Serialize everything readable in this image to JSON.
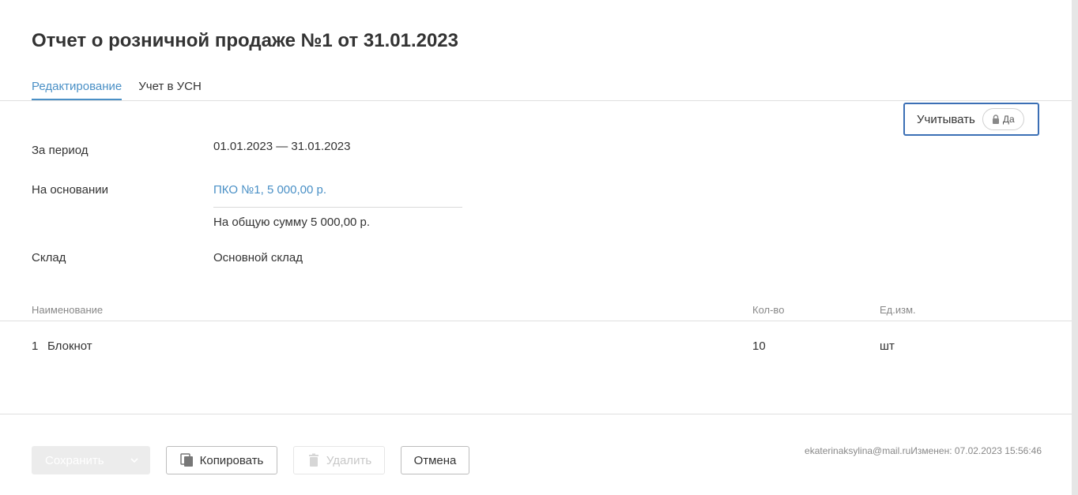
{
  "document": {
    "title": "Отчет о розничной продаже №1 от 31.01.2023"
  },
  "tabs": [
    {
      "label": "Редактирование",
      "active": true
    },
    {
      "label": "Учет в УСН",
      "active": false
    }
  ],
  "tax_accounting": {
    "label": "Учитывать",
    "value": "Да",
    "icon": "lock-icon"
  },
  "fields": {
    "period_label": "За период",
    "period_value": "01.01.2023 — 31.01.2023",
    "basis_label": "На основании",
    "basis_link": "ПКО №1, 5 000,00 р.",
    "basis_total": "На общую сумму 5 000,00 р.",
    "warehouse_label": "Склад",
    "warehouse_value": "Основной склад"
  },
  "table": {
    "headers": {
      "name": "Наименование",
      "qty": "Кол-во",
      "unit": "Ед.изм."
    },
    "rows": [
      {
        "num": "1",
        "name": "Блокнот",
        "qty": "10",
        "unit": "шт"
      }
    ]
  },
  "footer": {
    "save_label": "Сохранить",
    "copy_label": "Копировать",
    "delete_label": "Удалить",
    "cancel_label": "Отмена",
    "meta": "ekaterinaksylina@mail.ruИзменен: 07.02.2023 15:56:46"
  },
  "colors": {
    "accent": "#4a90c6",
    "focus_border": "#3b6fb5",
    "text": "#333333",
    "muted": "#888888"
  }
}
